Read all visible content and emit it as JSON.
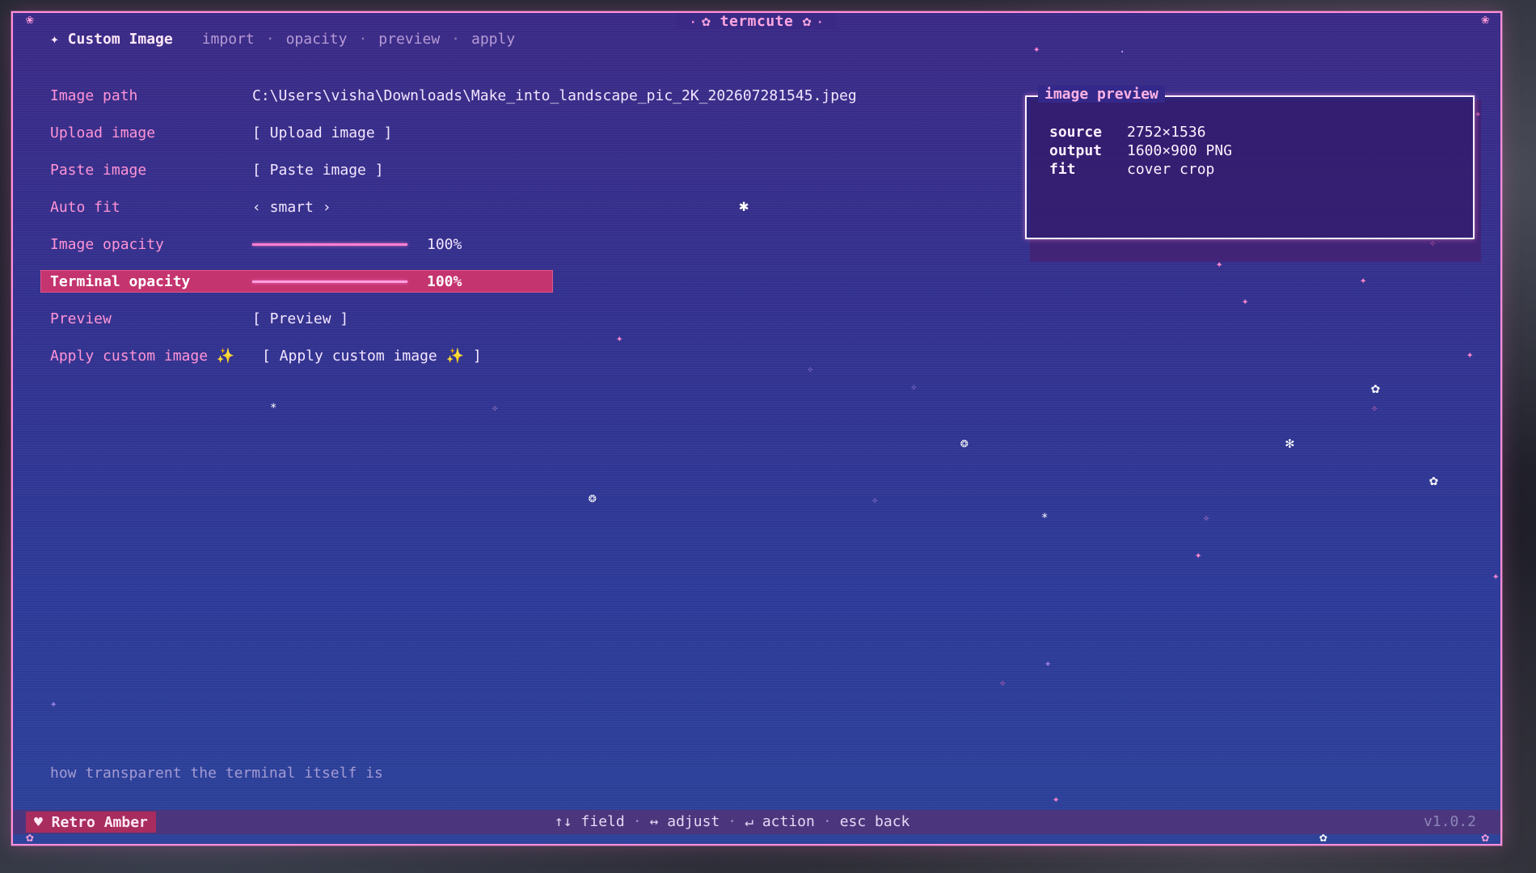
{
  "window": {
    "title": "termcute",
    "title_icon": "flower-icon"
  },
  "header": {
    "screen_title": "✦ Custom Image",
    "tabs": [
      "import",
      "opacity",
      "preview",
      "apply"
    ],
    "separator": "·"
  },
  "form": {
    "image_path": {
      "label": "Image path",
      "value": "C:\\Users\\visha\\Downloads\\Make_into_landscape_pic_2K_202607281545.jpeg"
    },
    "upload_image": {
      "label": "Upload image",
      "button": "[ Upload image ]"
    },
    "paste_image": {
      "label": "Paste image",
      "button": "[ Paste image ]"
    },
    "auto_fit": {
      "label": "Auto fit",
      "value": "‹ smart ›"
    },
    "image_opacity": {
      "label": "Image opacity",
      "value_text": "100%",
      "percent": 100
    },
    "terminal_opacity": {
      "label": "Terminal opacity",
      "value_text": "100%",
      "percent": 100
    },
    "preview": {
      "label": "Preview",
      "button": "[ Preview ]"
    },
    "apply": {
      "label": "Apply custom image ✨",
      "button": "[ Apply custom image ✨ ]"
    }
  },
  "preview_panel": {
    "title": "image preview",
    "rows": [
      {
        "key": "source",
        "value": "2752×1536"
      },
      {
        "key": "output",
        "value": "1600×900 PNG"
      },
      {
        "key": "fit",
        "value": "cover crop"
      }
    ]
  },
  "help_text": "how transparent the terminal itself is",
  "statusbar": {
    "theme": "♥ Retro Amber",
    "keys": [
      {
        "key": "↑↓",
        "action": "field"
      },
      {
        "key": "↔",
        "action": "adjust"
      },
      {
        "key": "↵",
        "action": "action"
      },
      {
        "key": "esc",
        "action": "back"
      }
    ],
    "version": "v1.0.2"
  },
  "colors": {
    "accent_pink": "#ff8fd8",
    "highlight_row": "#c4346f",
    "background_top": "#3a2a86",
    "background_bottom": "#2c4199"
  }
}
